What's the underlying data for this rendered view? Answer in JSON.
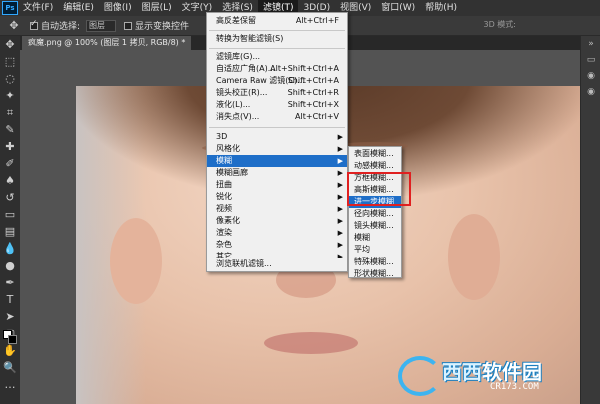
{
  "menubar": {
    "app_logo": "Ps",
    "items": [
      "文件(F)",
      "编辑(E)",
      "图像(I)",
      "图层(L)",
      "文字(Y)",
      "选择(S)",
      "滤镜(T)",
      "3D(D)",
      "视图(V)",
      "窗口(W)",
      "帮助(H)"
    ],
    "active_index": 6
  },
  "optionsbar": {
    "tool_icon": "move-tool-icon",
    "auto_select_checked": true,
    "auto_select_label": "自动选择:",
    "auto_select_value": "图层",
    "show_transform_label": "显示变换控件",
    "mode_3d": "3D 模式:"
  },
  "document": {
    "tab_title": "疯魔.png @ 100% (图层 1 拷贝, RGB/8) *"
  },
  "filter_menu": {
    "top_items": [
      {
        "label": "高反差保留",
        "shortcut": "Alt+Ctrl+F"
      },
      {
        "label": "转换为智能滤镜(S)",
        "shortcut": ""
      }
    ],
    "mid_items": [
      {
        "label": "滤镜库(G)...",
        "shortcut": ""
      },
      {
        "label": "自适应广角(A)...",
        "shortcut": "Alt+Shift+Ctrl+A"
      },
      {
        "label": "Camera Raw 滤镜(C)...",
        "shortcut": "Shift+Ctrl+A"
      },
      {
        "label": "镜头校正(R)...",
        "shortcut": "Shift+Ctrl+R"
      },
      {
        "label": "液化(L)...",
        "shortcut": "Shift+Ctrl+X"
      },
      {
        "label": "消失点(V)...",
        "shortcut": "Alt+Ctrl+V"
      }
    ],
    "sub_items": [
      {
        "label": "3D",
        "has_submenu": true
      },
      {
        "label": "风格化",
        "has_submenu": true
      },
      {
        "label": "模糊",
        "has_submenu": true
      },
      {
        "label": "模糊画廊",
        "has_submenu": true
      },
      {
        "label": "扭曲",
        "has_submenu": true
      },
      {
        "label": "锐化",
        "has_submenu": true
      },
      {
        "label": "视频",
        "has_submenu": true
      },
      {
        "label": "像素化",
        "has_submenu": true
      },
      {
        "label": "渲染",
        "has_submenu": true
      },
      {
        "label": "杂色",
        "has_submenu": true
      },
      {
        "label": "其它",
        "has_submenu": true
      }
    ],
    "highlighted_label": "模糊",
    "bottom_item": "浏览联机滤镜..."
  },
  "blur_submenu": {
    "items": [
      "表面模糊...",
      "动感模糊...",
      "方框模糊...",
      "高斯模糊...",
      "进一步模糊",
      "径向模糊...",
      "镜头模糊...",
      "模糊",
      "平均",
      "特殊模糊...",
      "形状模糊..."
    ],
    "highlighted_index": 4
  },
  "colors": {
    "menu_highlight": "#1e6ec8",
    "annotation_red": "#e02020",
    "foreground_swatch": "#ffffff",
    "background_swatch": "#000000"
  },
  "watermark": {
    "name_part1": "西西",
    "name_part2": "软件园",
    "url": "CR173.COM"
  }
}
